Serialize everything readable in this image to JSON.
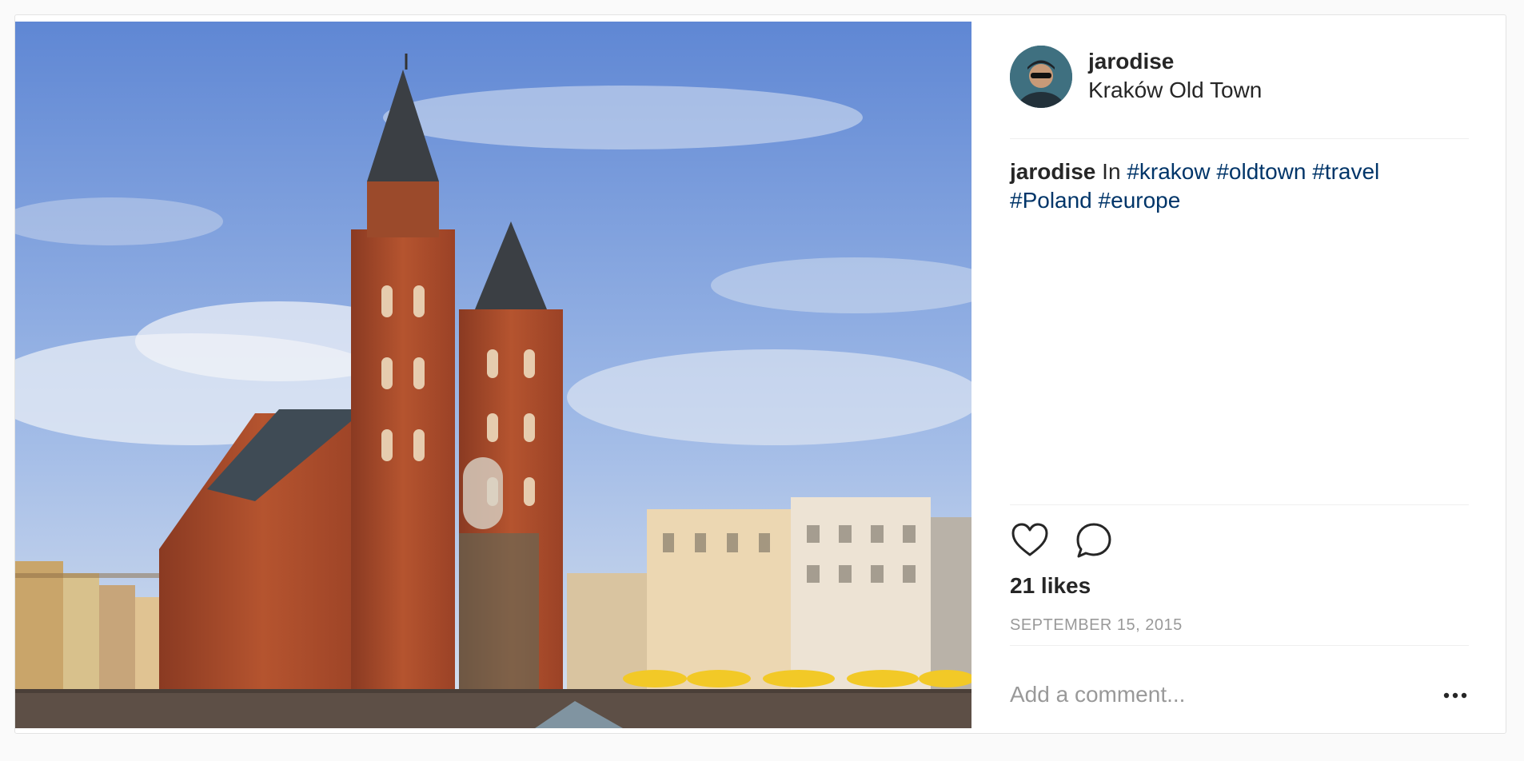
{
  "post": {
    "username": "jarodise",
    "location": "Kraków Old Town",
    "caption": {
      "user": "jarodise",
      "text": "In",
      "tags": [
        "#krakow",
        "#oldtown",
        "#travel",
        "#Poland",
        "#europe"
      ]
    },
    "likes": "21 likes",
    "date": "SEPTEMBER 15, 2015",
    "comment_placeholder": "Add a comment..."
  },
  "icons": {
    "like": "heart-icon",
    "comment": "comment-bubble-icon",
    "more": "more-options-icon"
  },
  "colors": {
    "text": "#262626",
    "hashtag": "#003569",
    "muted": "#999999",
    "divider": "#efefef"
  }
}
